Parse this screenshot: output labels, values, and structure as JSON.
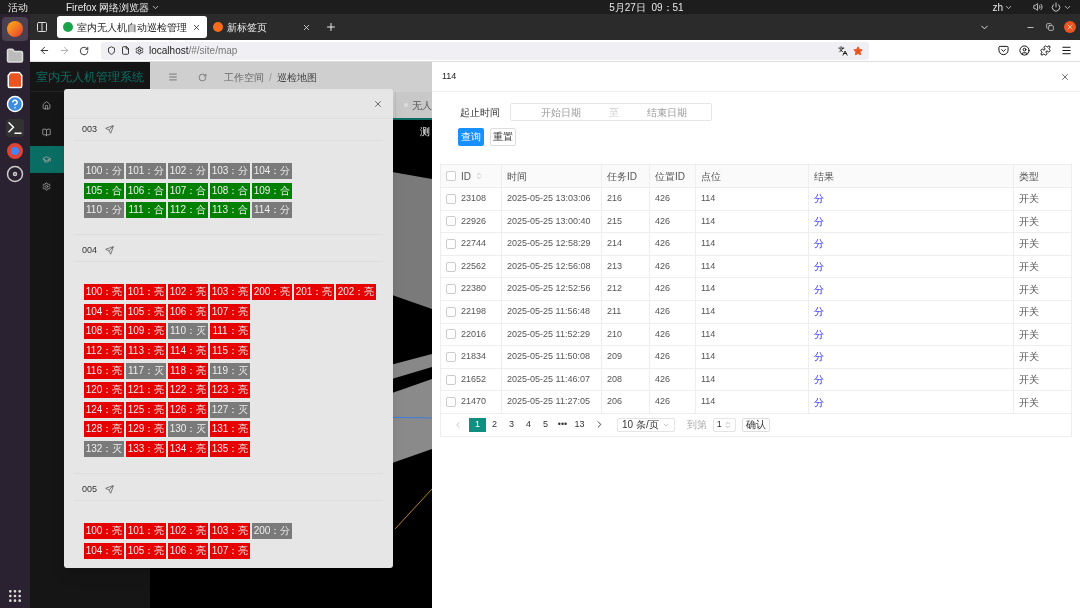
{
  "system_bar": {
    "activities": "活动",
    "app_menu": "Firefox 网络浏览器",
    "clock": "5月27日  09：51",
    "language": "zh"
  },
  "browser": {
    "tabs": [
      {
        "title": "室内无人机自动巡检管理",
        "selected": true
      },
      {
        "title": "新标签页",
        "selected": false
      }
    ],
    "url_host": "localhost",
    "url_path": "/#/site/map"
  },
  "app": {
    "title": "室内无人机管理系统",
    "sidebar": [
      {
        "selected": false
      },
      {
        "selected": false
      },
      {
        "selected": true
      },
      {
        "selected": false
      }
    ],
    "breadcrumb": [
      "工作空间",
      "巡检地图"
    ],
    "breadcrumb_separator": "/",
    "page_tab": "无人",
    "view_label": "测"
  },
  "status_modal": {
    "groups": [
      {
        "name": "003",
        "rows": [
          [
            {
              "label": "100：分",
              "color": "#7a7a7a"
            },
            {
              "label": "101：分",
              "color": "#7a7a7a"
            },
            {
              "label": "102：分",
              "color": "#7a7a7a"
            },
            {
              "label": "103：分",
              "color": "#7a7a7a"
            },
            {
              "label": "104：分",
              "color": "#7a7a7a"
            }
          ],
          [
            {
              "label": "105：合",
              "color": "#008000"
            },
            {
              "label": "106：合",
              "color": "#008000"
            },
            {
              "label": "107：合",
              "color": "#008000"
            },
            {
              "label": "108：合",
              "color": "#008000"
            },
            {
              "label": "109：合",
              "color": "#008000"
            }
          ],
          [
            {
              "label": "110：分",
              "color": "#7a7a7a"
            },
            {
              "label": "111：合",
              "color": "#008000"
            },
            {
              "label": "112：合",
              "color": "#008000"
            },
            {
              "label": "113：合",
              "color": "#008000"
            },
            {
              "label": "114：分",
              "color": "#7a7a7a"
            }
          ]
        ]
      },
      {
        "name": "004",
        "rows": [
          [
            {
              "label": "100：亮",
              "color": "#e60000"
            },
            {
              "label": "101：亮",
              "color": "#e60000"
            },
            {
              "label": "102：亮",
              "color": "#e60000"
            },
            {
              "label": "103：亮",
              "color": "#e60000"
            },
            {
              "label": "200：亮",
              "color": "#e60000"
            },
            {
              "label": "201：亮",
              "color": "#e60000"
            },
            {
              "label": "202：亮",
              "color": "#e60000"
            }
          ],
          [
            {
              "label": "104：亮",
              "color": "#e60000"
            },
            {
              "label": "105：亮",
              "color": "#e60000"
            },
            {
              "label": "106：亮",
              "color": "#e60000"
            },
            {
              "label": "107：亮",
              "color": "#e60000"
            }
          ],
          [
            {
              "label": "108：亮",
              "color": "#e60000"
            },
            {
              "label": "109：亮",
              "color": "#e60000"
            },
            {
              "label": "110：灭",
              "color": "#7a7a7a"
            },
            {
              "label": "111：亮",
              "color": "#e60000"
            }
          ],
          [
            {
              "label": "112：亮",
              "color": "#e60000"
            },
            {
              "label": "113：亮",
              "color": "#e60000"
            },
            {
              "label": "114：亮",
              "color": "#e60000"
            },
            {
              "label": "115：亮",
              "color": "#e60000"
            }
          ],
          [
            {
              "label": "116：亮",
              "color": "#e60000"
            },
            {
              "label": "117：灭",
              "color": "#7a7a7a"
            },
            {
              "label": "118：亮",
              "color": "#e60000"
            },
            {
              "label": "119：灭",
              "color": "#7a7a7a"
            }
          ],
          [
            {
              "label": "120：亮",
              "color": "#e60000"
            },
            {
              "label": "121：亮",
              "color": "#e60000"
            },
            {
              "label": "122：亮",
              "color": "#e60000"
            },
            {
              "label": "123：亮",
              "color": "#e60000"
            }
          ],
          [
            {
              "label": "124：亮",
              "color": "#e60000"
            },
            {
              "label": "125：亮",
              "color": "#e60000"
            },
            {
              "label": "126：亮",
              "color": "#e60000"
            },
            {
              "label": "127：灭",
              "color": "#7a7a7a"
            }
          ],
          [
            {
              "label": "128：亮",
              "color": "#e60000"
            },
            {
              "label": "129：亮",
              "color": "#e60000"
            },
            {
              "label": "130：灭",
              "color": "#7a7a7a"
            },
            {
              "label": "131：亮",
              "color": "#e60000"
            }
          ],
          [
            {
              "label": "132：灭",
              "color": "#7a7a7a"
            },
            {
              "label": "133：亮",
              "color": "#e60000"
            },
            {
              "label": "134：亮",
              "color": "#e60000"
            },
            {
              "label": "135：亮",
              "color": "#e60000"
            }
          ]
        ]
      },
      {
        "name": "005",
        "rows": [
          [
            {
              "label": "100：亮",
              "color": "#e60000"
            },
            {
              "label": "101：亮",
              "color": "#e60000"
            },
            {
              "label": "102：亮",
              "color": "#e60000"
            },
            {
              "label": "103：亮",
              "color": "#e60000"
            },
            {
              "label": "200：分",
              "color": "#7a7a7a"
            }
          ],
          [
            {
              "label": "104：亮",
              "color": "#e60000"
            },
            {
              "label": "105：亮",
              "color": "#e60000"
            },
            {
              "label": "106：亮",
              "color": "#e60000"
            },
            {
              "label": "107：亮",
              "color": "#e60000"
            }
          ]
        ]
      }
    ]
  },
  "detail_drawer": {
    "title": "114",
    "filter_label": "起止时间",
    "start_placeholder": "开始日期",
    "range_separator": "至",
    "end_placeholder": "结束日期",
    "buttons": [
      {
        "label": "查询",
        "kind": "primary"
      },
      {
        "label": "重置",
        "kind": "default"
      }
    ],
    "table": {
      "select_all_checked": false,
      "columns": [
        "ID",
        "时间",
        "任务ID",
        "位置ID",
        "点位",
        "结果",
        "类型"
      ],
      "rows": [
        {
          "checked": false,
          "cells": [
            "23108",
            "2025-05-25 13:03:06",
            "216",
            "426",
            "114",
            "分",
            "开关"
          ]
        },
        {
          "checked": false,
          "cells": [
            "22926",
            "2025-05-25 13:00:40",
            "215",
            "426",
            "114",
            "分",
            "开关"
          ]
        },
        {
          "checked": false,
          "cells": [
            "22744",
            "2025-05-25 12:58:29",
            "214",
            "426",
            "114",
            "分",
            "开关"
          ]
        },
        {
          "checked": false,
          "cells": [
            "22562",
            "2025-05-25 12:56:08",
            "213",
            "426",
            "114",
            "分",
            "开关"
          ]
        },
        {
          "checked": false,
          "cells": [
            "22380",
            "2025-05-25 12:52:56",
            "212",
            "426",
            "114",
            "分",
            "开关"
          ]
        },
        {
          "checked": false,
          "cells": [
            "22198",
            "2025-05-25 11:56:48",
            "211",
            "426",
            "114",
            "分",
            "开关"
          ]
        },
        {
          "checked": false,
          "cells": [
            "22016",
            "2025-05-25 11:52:29",
            "210",
            "426",
            "114",
            "分",
            "开关"
          ]
        },
        {
          "checked": false,
          "cells": [
            "21834",
            "2025-05-25 11:50:08",
            "209",
            "426",
            "114",
            "分",
            "开关"
          ]
        },
        {
          "checked": false,
          "cells": [
            "21652",
            "2025-05-25 11:46:07",
            "208",
            "426",
            "114",
            "分",
            "开关"
          ]
        },
        {
          "checked": false,
          "cells": [
            "21470",
            "2025-05-25 11:27:05",
            "206",
            "426",
            "114",
            "分",
            "开关"
          ]
        }
      ]
    },
    "pagination": {
      "pages": [
        {
          "label": "1",
          "selected": true
        },
        {
          "label": "2",
          "selected": false
        },
        {
          "label": "3",
          "selected": false
        },
        {
          "label": "4",
          "selected": false
        },
        {
          "label": "5",
          "selected": false
        },
        {
          "label": "•••",
          "selected": false
        },
        {
          "label": "13",
          "selected": false
        }
      ],
      "page_size": "10 条/页",
      "goto_label": "到第",
      "goto_value": "1",
      "confirm": "确认"
    }
  }
}
